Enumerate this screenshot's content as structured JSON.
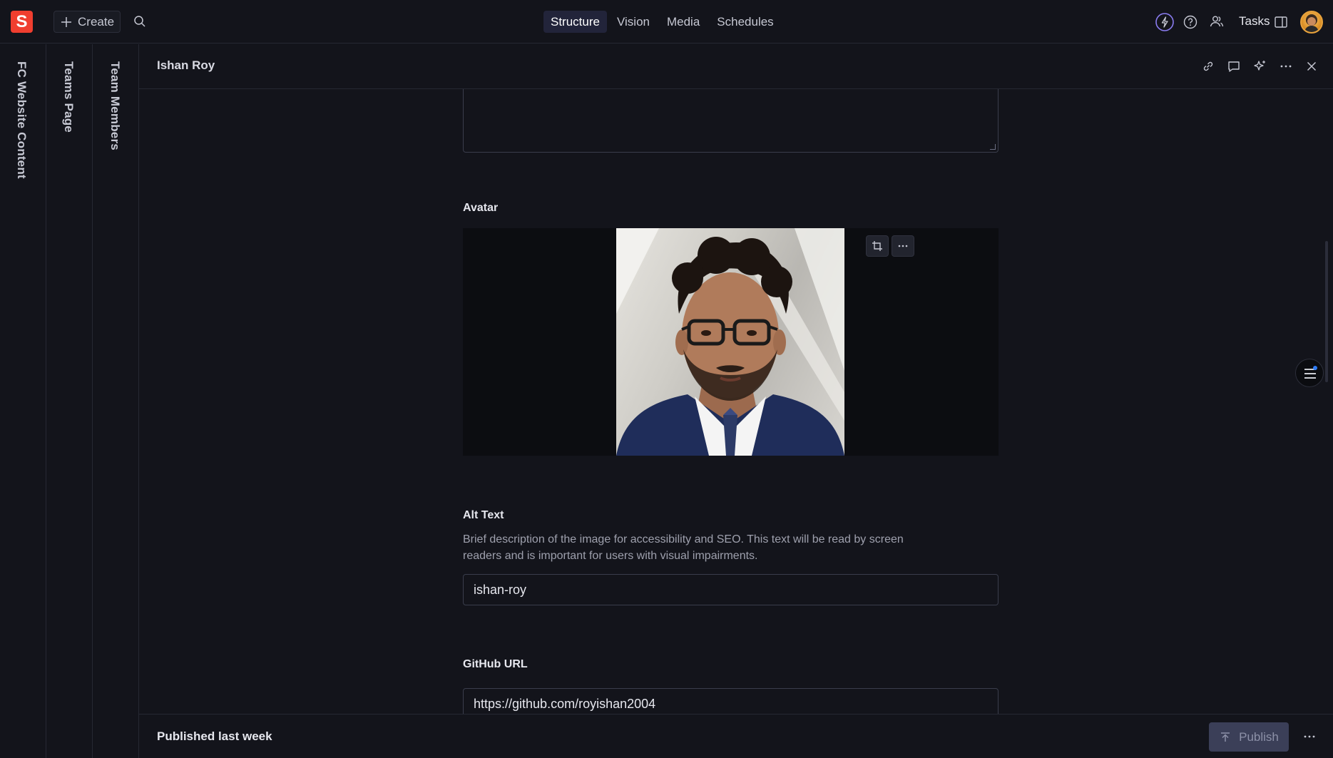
{
  "topbar": {
    "logo_letter": "S",
    "create_label": "Create",
    "nav": [
      {
        "label": "Structure",
        "active": true
      },
      {
        "label": "Vision",
        "active": false
      },
      {
        "label": "Media",
        "active": false
      },
      {
        "label": "Schedules",
        "active": false
      }
    ],
    "tasks_label": "Tasks"
  },
  "rails": [
    {
      "label": "FC Website Content"
    },
    {
      "label": "Teams Page"
    },
    {
      "label": "Team Members"
    }
  ],
  "document": {
    "title": "Ishan Roy",
    "avatar_label": "Avatar",
    "alt_text_label": "Alt Text",
    "alt_text_description": "Brief description of the image for accessibility and SEO. This text will be read by screen readers and is important for users with visual impairments.",
    "alt_text_value": "ishan-roy",
    "github_label": "GitHub URL",
    "github_value": "https://github.com/royishan2004"
  },
  "footer": {
    "status": "Published last week",
    "publish_label": "Publish"
  },
  "colors": {
    "background": "#13141b",
    "brand": "#f03e2f",
    "border": "#262833",
    "publish_bg": "#3b3f58",
    "accent_dot": "#2f7cf6"
  }
}
